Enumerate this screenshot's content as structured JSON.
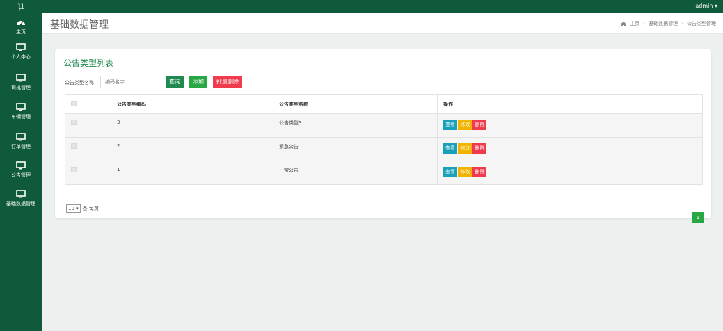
{
  "app": {
    "logo": "μ",
    "user": "admin ▾"
  },
  "sidebar": {
    "items": [
      {
        "label": "主页",
        "icon": "dashboard-icon"
      },
      {
        "label": "个人中心",
        "icon": "monitor-icon"
      },
      {
        "label": "司机管理",
        "icon": "monitor-icon"
      },
      {
        "label": "车辆管理",
        "icon": "monitor-icon"
      },
      {
        "label": "订单管理",
        "icon": "monitor-icon"
      },
      {
        "label": "公告管理",
        "icon": "monitor-icon"
      },
      {
        "label": "基础数据管理",
        "icon": "monitor-icon"
      }
    ]
  },
  "header": {
    "title": "基础数据管理",
    "breadcrumb": [
      "主页",
      "基础数据管理",
      "公告类型管理"
    ],
    "breadcrumb_sep": "›"
  },
  "panel": {
    "title": "公告类型列表",
    "search_label": "公告类型名称",
    "search_placeholder": "编码名字",
    "query_label": "查询",
    "add_label": "添加",
    "batch_delete_label": "批量删除"
  },
  "table": {
    "headers": [
      "公告类型编码",
      "公告类型名称",
      "操作"
    ],
    "rows": [
      {
        "code": "3",
        "name": "公告类型3"
      },
      {
        "code": "2",
        "name": "紧急公告"
      },
      {
        "code": "1",
        "name": "日常公告"
      }
    ],
    "actions": {
      "view": "查看",
      "edit": "修改",
      "delete": "删除"
    }
  },
  "pagination": {
    "page_size": "10",
    "page_size_suffix": "条 每页",
    "current_page": "1"
  },
  "colors": {
    "brand": "#0f5a3a",
    "primary": "#1f8a4f",
    "success": "#2aa745",
    "danger": "#ef3b4d",
    "info": "#1aa0b8",
    "warning": "#f0b400"
  }
}
